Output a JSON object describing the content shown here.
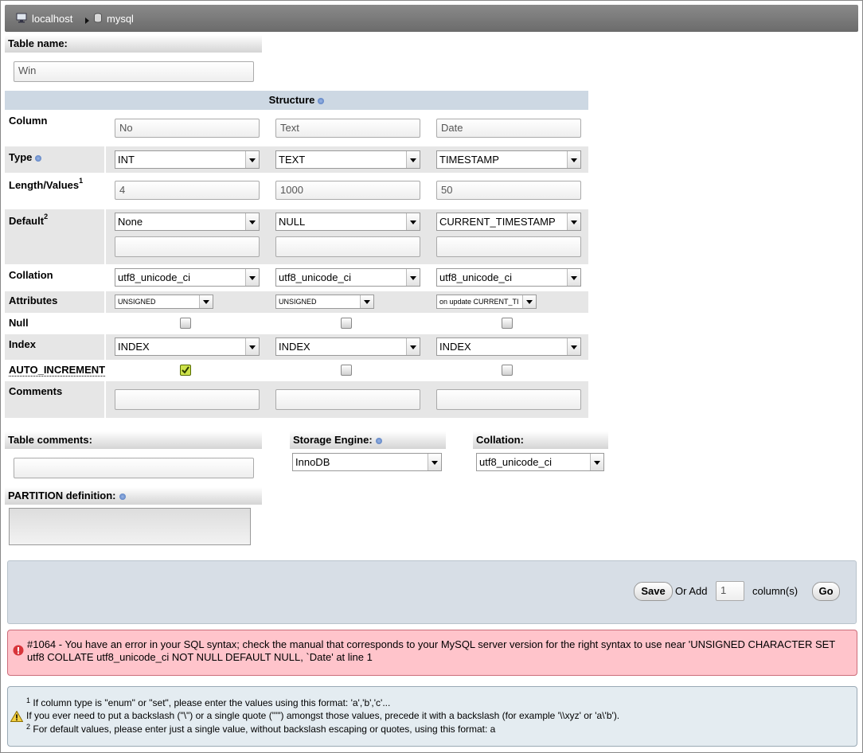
{
  "breadcrumb": {
    "server": "localhost",
    "database": "mysql"
  },
  "table_name": {
    "label": "Table name:",
    "value": "Win"
  },
  "structure": {
    "title": "Structure",
    "row_labels": {
      "column": "Column",
      "type": "Type",
      "length": "Length/Values",
      "length_sup": "1",
      "default": "Default",
      "default_sup": "2",
      "collation": "Collation",
      "attributes": "Attributes",
      "null": "Null",
      "index": "Index",
      "auto_increment": "AUTO_INCREMENT",
      "comments": "Comments"
    },
    "columns": [
      {
        "name": "No",
        "type": "INT",
        "length": "4",
        "default": "None",
        "default_value": "",
        "collation": "utf8_unicode_ci",
        "attributes": "UNSIGNED",
        "null": false,
        "index": "INDEX",
        "auto_increment": true,
        "comments": ""
      },
      {
        "name": "Text",
        "type": "TEXT",
        "length": "1000",
        "default": "NULL",
        "default_value": "",
        "collation": "utf8_unicode_ci",
        "attributes": "UNSIGNED",
        "null": false,
        "index": "INDEX",
        "auto_increment": false,
        "comments": ""
      },
      {
        "name": "Date",
        "type": "TIMESTAMP",
        "length": "50",
        "default": "CURRENT_TIMESTAMP",
        "default_value": "",
        "collation": "utf8_unicode_ci",
        "attributes": "on update CURRENT_TI",
        "null": false,
        "index": "INDEX",
        "auto_increment": false,
        "comments": ""
      }
    ]
  },
  "table_comments": {
    "label": "Table comments:",
    "value": ""
  },
  "storage_engine": {
    "label": "Storage Engine:",
    "value": "InnoDB"
  },
  "table_collation": {
    "label": "Collation:",
    "value": "utf8_unicode_ci"
  },
  "partition": {
    "label": "PARTITION definition:",
    "value": ""
  },
  "footer": {
    "save_label": "Save",
    "or_add": "Or Add",
    "add_count": "1",
    "columns_label": "column(s)",
    "go_label": "Go"
  },
  "error": {
    "line1": "#1064 - You have an error in your SQL syntax; check the manual that corresponds to your MySQL server version for the right syntax to use near 'UNSIGNED CHARACTER SET",
    "line2": "utf8 COLLATE utf8_unicode_ci NOT NULL DEFAULT NULL, `Date' at line 1"
  },
  "notes": {
    "sup1": "1",
    "line1": "If column type is \"enum\" or \"set\", please enter the values using this format: 'a','b','c'...",
    "line2": "If you ever need to put a backslash (\"\\\") or a single quote (\"'\") amongst those values, precede it with a backslash (for example '\\\\xyz' or 'a\\'b').",
    "sup2": "2",
    "line3": "For default values, please enter just a single value, without backslash escaping or quotes, using this format: a"
  }
}
